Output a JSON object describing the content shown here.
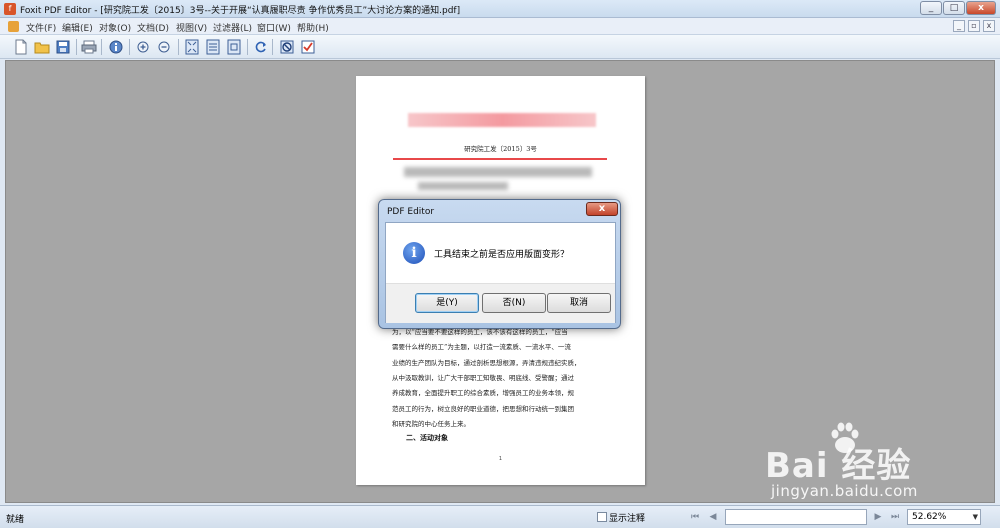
{
  "window": {
    "title": "Foxit PDF Editor - [研究院工发〔2015〕3号--关于开展“认真履职尽责 争作优秀员工”大讨论方案的通知.pdf]",
    "controls": [
      "_",
      "□",
      "x"
    ]
  },
  "menu": {
    "items": [
      "文件(F)",
      "编辑(E)",
      "对象(O)",
      "文档(D)",
      "视图(V)",
      "过滤器(L)",
      "窗口(W)",
      "帮助(H)"
    ],
    "mdi_controls": [
      "_",
      "▫",
      "x"
    ]
  },
  "toolbar": {
    "buttons": [
      "new-icon",
      "open-folder-icon",
      "save-icon",
      "print-icon",
      "info-icon",
      "zoom-in-icon",
      "zoom-out-icon",
      "fit-page-icon",
      "fit-width-icon",
      "actual-size-icon",
      "rotate-icon",
      "stop-icon",
      "checkbox-icon"
    ]
  },
  "document": {
    "doc_number": "研究院工发〔2015〕3号",
    "body_lines": [
      "为，以“应当要不要这样的员工，该不该有这样的员工，“应当",
      "需要什么样的员工”为主题，以打造一流素质、一流水平、一流",
      "业绩的生产团队为目标，通过剖析思想根源，弄清违规违纪实质，",
      "从中汲取教训，让广大干部职工知敬畏、明底线、受警醒；通过",
      "养成教育，全面提升职工的综合素质，增强员工的业务本领，规",
      "范员工的行为，树立良好的职业道德，把思想和行动统一到集团",
      "和研究院的中心任务上来。"
    ],
    "section_title": "二、活动对象",
    "page_number": "1"
  },
  "dialog": {
    "title": "PDF Editor",
    "close_label": "x",
    "icon": "information-icon",
    "message": "工具结束之前是否应用版面变形？",
    "buttons": {
      "yes": "是(Y)",
      "no": "否(N)",
      "cancel": "取消"
    }
  },
  "status": {
    "text": "就绪",
    "show_annotations_label": "显示注释",
    "show_annotations_checked": false,
    "page_field_value": "",
    "zoom": "52.62%"
  },
  "watermark": {
    "logo": "Bai  经验",
    "url": "jingyan.baidu.com"
  }
}
